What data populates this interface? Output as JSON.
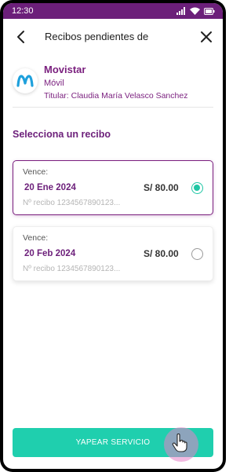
{
  "status_bar": {
    "time": "12:30"
  },
  "header": {
    "title": "Recibos pendientes de"
  },
  "provider": {
    "name": "Movistar",
    "service": "Móvil",
    "holder": "Titular: Claudia María Velasco Sanchez"
  },
  "section": {
    "title": "Selecciona un recibo"
  },
  "receipts": [
    {
      "due_label": "Vence:",
      "due_date": "20 Ene 2024",
      "amount": "S/ 80.00",
      "number": "Nº recibo 1234567890123...",
      "selected": true
    },
    {
      "due_label": "Vence:",
      "due_date": "20 Feb 2024",
      "amount": "S/ 80.00",
      "number": "Nº recibo 1234567890123...",
      "selected": false
    }
  ],
  "cta": {
    "label": "YAPEAR SERVICIO"
  },
  "colors": {
    "brand_purple": "#6c1f7a",
    "accent_teal": "#1fcfae",
    "movistar_blue": "#1ea0dc"
  },
  "icons": [
    "back-arrow-icon",
    "close-icon",
    "movistar-logo-icon",
    "signal-icon",
    "wifi-icon",
    "battery-icon",
    "hand-cursor-icon"
  ]
}
